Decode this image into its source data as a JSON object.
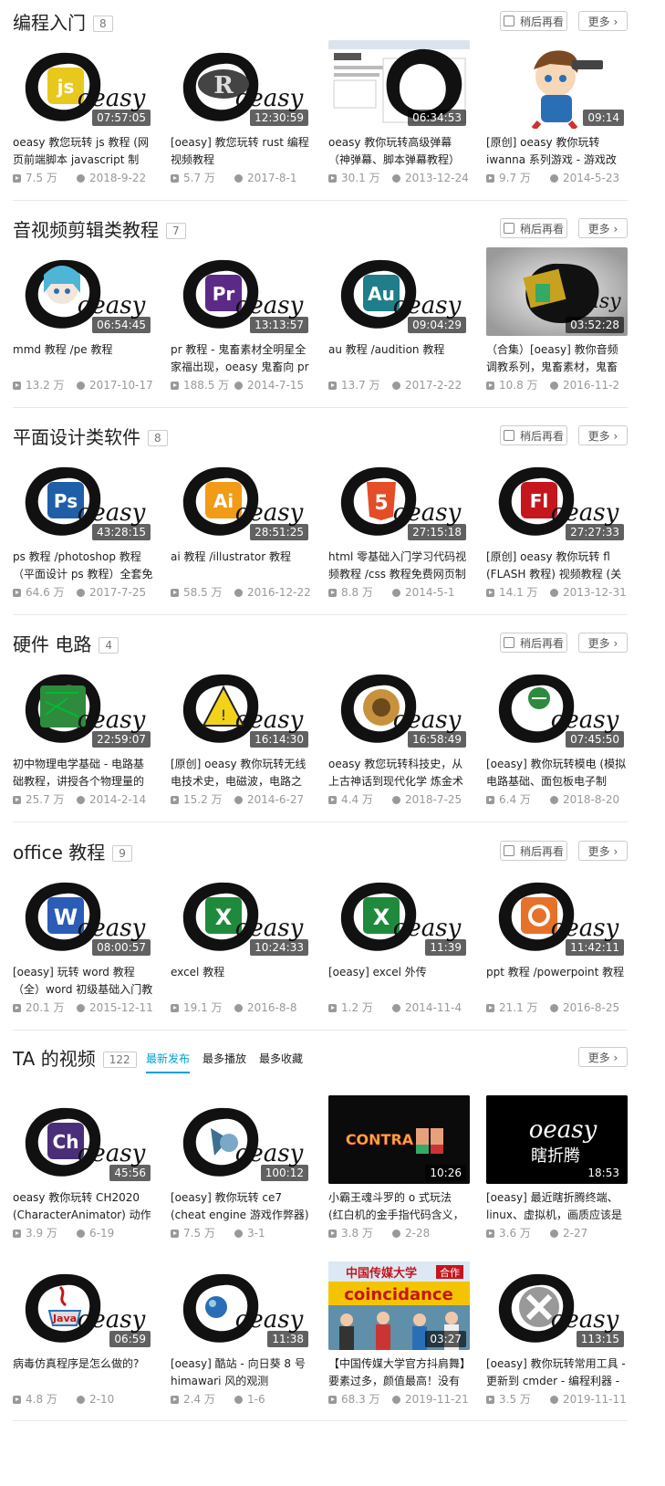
{
  "sections": [
    {
      "title": "编程入门",
      "count": "8",
      "later": "稍后再看",
      "more": "更多",
      "videos": [
        {
          "title": "oeasy 教您玩转 js 教程 (网页前端脚本 javascript 制作)、",
          "duration": "07:57:05",
          "views": "7.5 万",
          "date": "2018-9-22",
          "thumb": "js",
          "color": "#e9c81d"
        },
        {
          "title": "[oeasy] 教您玩转 rust 编程视频教程",
          "duration": "12:30:59",
          "views": "5.7 万",
          "date": "2017-8-1",
          "thumb": "R",
          "color": "#c0392b"
        },
        {
          "title": "oeasy 教你玩转高级弹幕（神弹幕、脚本弹幕教程）",
          "duration": "06:34:53",
          "views": "30.1 万",
          "date": "2013-12-24",
          "thumb": "screen",
          "color": "#888888"
        },
        {
          "title": "[原创] oeasy 教你玩转 iwanna 系列游戏 - 游戏改",
          "duration": "09:14",
          "views": "9.7 万",
          "date": "2014-5-23",
          "thumb": "kid",
          "color": "#2a6fb5"
        }
      ]
    },
    {
      "title": "音视频剪辑类教程",
      "count": "7",
      "later": "稍后再看",
      "more": "更多",
      "videos": [
        {
          "title": "mmd 教程 /pe 教程",
          "duration": "06:54:45",
          "views": "13.2 万",
          "date": "2017-10-17",
          "thumb": "miku",
          "color": "#4fb5d6"
        },
        {
          "title": "pr 教程 - 鬼畜素材全明星全家福出现，oeasy 鬼畜向 pr",
          "duration": "13:13:57",
          "views": "188.5 万",
          "date": "2014-7-15",
          "thumb": "Pr",
          "color": "#5b2a86"
        },
        {
          "title": "au 教程 /audition 教程",
          "duration": "09:04:29",
          "views": "13.7 万",
          "date": "2017-2-22",
          "thumb": "Au",
          "color": "#1f7e8a"
        },
        {
          "title": "（合集）[oeasy] 教你音频调教系列，鬼畜素材，鬼畜调",
          "duration": "03:52:28",
          "views": "10.8 万",
          "date": "2016-11-2",
          "thumb": "book",
          "color": "#c7a21e"
        }
      ]
    },
    {
      "title": "平面设计类软件",
      "count": "8",
      "later": "稍后再看",
      "more": "更多",
      "videos": [
        {
          "title": "ps 教程 /photoshop 教程（平面设计 ps 教程）全套免",
          "duration": "43:28:15",
          "views": "64.6 万",
          "date": "2017-7-25",
          "thumb": "Ps",
          "color": "#1f5fa8"
        },
        {
          "title": "ai 教程 /illustrator 教程",
          "duration": "28:51:25",
          "views": "58.5 万",
          "date": "2016-12-22",
          "thumb": "Ai",
          "color": "#f29b16"
        },
        {
          "title": "html 零基础入门学习代码视频教程 /css 教程免费网页制",
          "duration": "27:15:18",
          "views": "8.8 万",
          "date": "2014-5-1",
          "thumb": "5",
          "color": "#e44d26"
        },
        {
          "title": "[原创] oeasy 教你玩转 fl (FLASH 教程) 视频教程 (关",
          "duration": "27:27:33",
          "views": "14.1 万",
          "date": "2013-12-31",
          "thumb": "Fl",
          "color": "#c4161c"
        }
      ]
    },
    {
      "title": "硬件 电路",
      "count": "4",
      "later": "稍后再看",
      "more": "更多",
      "videos": [
        {
          "title": "初中物理电学基础 - 电路基础教程，讲授各个物理量的由",
          "duration": "22:59:07",
          "views": "25.7 万",
          "date": "2014-2-14",
          "thumb": "chip",
          "color": "#2e8b3e"
        },
        {
          "title": "[原创] oeasy 教你玩转无线电技术史，电磁波，电路之后的",
          "duration": "16:14:30",
          "views": "15.2 万",
          "date": "2014-6-27",
          "thumb": "warn",
          "color": "#f3d21a"
        },
        {
          "title": "oeasy 教您玩转科技史，从上古神话到现代化学 炼金术 修",
          "duration": "16:58:49",
          "views": "4.4 万",
          "date": "2018-7-25",
          "thumb": "alch",
          "color": "#c8913e"
        },
        {
          "title": "[oeasy] 教你玩转模电 (模拟电路基础、面包板电子制作、",
          "duration": "07:45:50",
          "views": "6.4 万",
          "date": "2018-8-20",
          "thumb": "board",
          "color": "#2e8b3e"
        }
      ]
    },
    {
      "title": "office 教程",
      "count": "9",
      "later": "稍后再看",
      "more": "更多",
      "videos": [
        {
          "title": "[oeasy] 玩转 word 教程（全）word 初级基础入门教",
          "duration": "08:00:57",
          "views": "20.1 万",
          "date": "2015-12-11",
          "thumb": "W",
          "color": "#2a5cb8"
        },
        {
          "title": "excel 教程",
          "duration": "10:24:33",
          "views": "19.1 万",
          "date": "2016-8-8",
          "thumb": "X",
          "color": "#1f8a3c"
        },
        {
          "title": "[oeasy] excel 外传",
          "duration": "11:39",
          "views": "1.2 万",
          "date": "2014-11-4",
          "thumb": "X",
          "color": "#1f8a3c"
        },
        {
          "title": "ppt 教程 /powerpoint 教程",
          "duration": "11:42:11",
          "views": "21.1 万",
          "date": "2016-8-25",
          "thumb": "P",
          "color": "#e6722a"
        }
      ]
    }
  ],
  "ta": {
    "title": "TA 的视频",
    "count": "122",
    "tabs": [
      "最新发布",
      "最多播放",
      "最多收藏"
    ],
    "more": "更多",
    "videos": [
      {
        "title": "oeasy 教你玩转 CH2020 (CharacterAnimator) 动作",
        "duration": "45:56",
        "views": "3.9 万",
        "date": "6-19",
        "thumb": "Ch",
        "color": "#4a2e7a"
      },
      {
        "title": "[oeasy] 教你玩转 ce7 (cheat engine 游戏作弊器)",
        "duration": "100:12",
        "views": "7.5 万",
        "date": "3-1",
        "thumb": "ce",
        "color": "#3d6f8f"
      },
      {
        "title": "小霸王魂斗罗的 o 式玩法 (红白机的金手指代码含义，以及",
        "duration": "10:26",
        "views": "3.8 万",
        "date": "2-28",
        "thumb": "contra",
        "color": "#000000"
      },
      {
        "title": "[oeasy] 最近瞎折腾终端、linux、虚拟机，画质应该是",
        "duration": "18:53",
        "views": "3.6 万",
        "date": "2-27",
        "thumb": "text",
        "color": "#000000"
      },
      {
        "title": "病毒仿真程序是怎么做的?",
        "duration": "06:59",
        "views": "4.8 万",
        "date": "2-10",
        "thumb": "java",
        "color": "#c4161c"
      },
      {
        "title": "[oeasy] 酷站 - 向日葵 8 号 himawari 风的观测",
        "duration": "11:38",
        "views": "2.4 万",
        "date": "1-6",
        "thumb": "earth",
        "color": "#2a6fb5"
      },
      {
        "title": "【中国传媒大学官方抖肩舞】要素过多，颜值最高！没有白",
        "duration": "03:27",
        "views": "68.3 万",
        "date": "2019-11-21",
        "thumb": "cuc",
        "color": "#f5c400"
      },
      {
        "title": "[oeasy] 教你玩转常用工具 - 更新到 cmder - 编程利器 -",
        "duration": "113:15",
        "views": "3.5 万",
        "date": "2019-11-11",
        "thumb": "tools",
        "color": "#888888"
      }
    ],
    "contra_text": "CONTRA",
    "oeasy_text": "oeasy",
    "tinker_text": "瞎折腾",
    "cuc_banner": "中国传媒大学",
    "cuc_tag": "合作",
    "cuc_word": "coincidance"
  },
  "brand_text": "oeasy"
}
